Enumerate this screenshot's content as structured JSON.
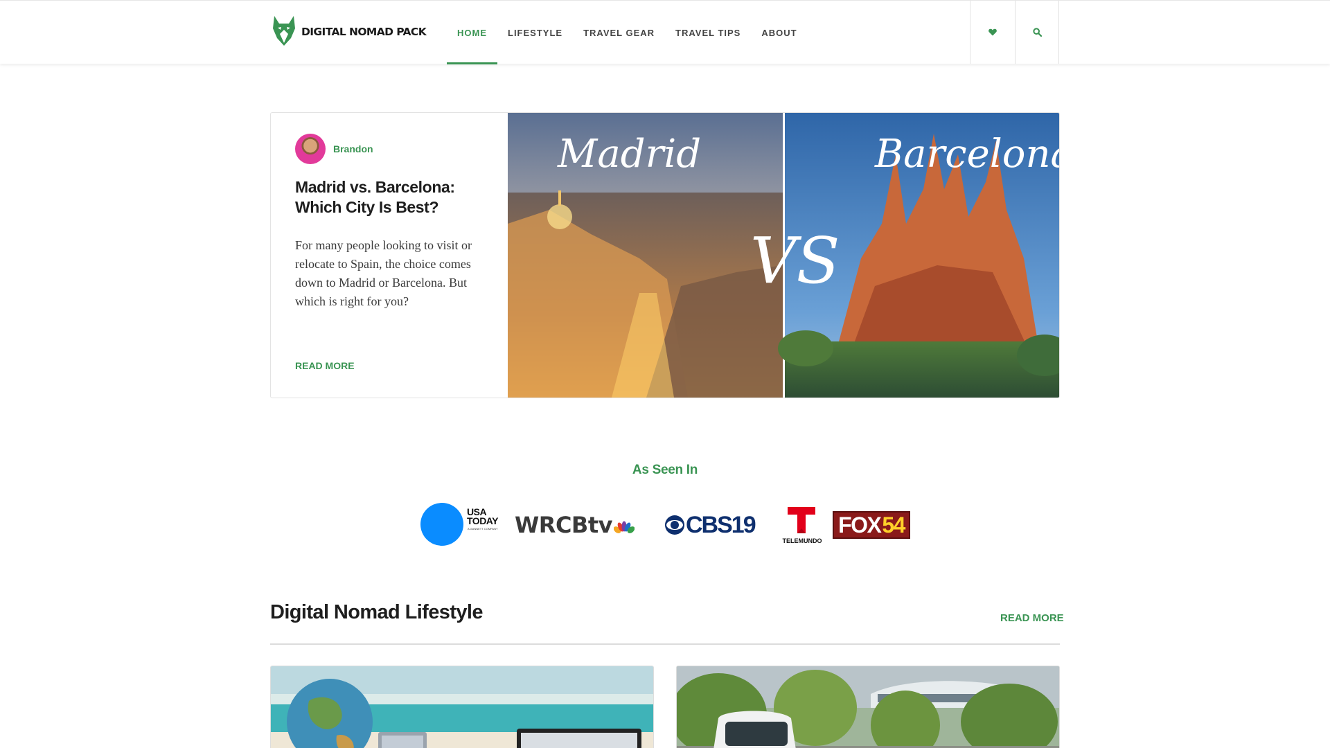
{
  "brand": {
    "name": "DIGITAL NOMAD PACK",
    "accent": "#3a9453"
  },
  "nav": {
    "items": [
      {
        "label": "HOME",
        "active": true
      },
      {
        "label": "LIFESTYLE",
        "active": false
      },
      {
        "label": "TRAVEL GEAR",
        "active": false
      },
      {
        "label": "TRAVEL TIPS",
        "active": false
      },
      {
        "label": "ABOUT",
        "active": false
      }
    ],
    "icons": [
      "heart-icon",
      "search-icon"
    ]
  },
  "featured": {
    "author": "Brandon",
    "title": "Madrid vs. Barcelona: Which City Is Best?",
    "excerpt": "For many people looking to visit or relocate to Spain, the choice comes down to Madrid or Barcelona. But which is right for you?",
    "read_more": "READ MORE",
    "image": {
      "left_label": "Madrid",
      "center_label": "VS",
      "right_label": "Barcelona"
    }
  },
  "as_seen_in": {
    "title": "As Seen In",
    "logos": [
      {
        "name": "USA TODAY",
        "line1": "USA",
        "line2": "TODAY",
        "tagline": "A GANNETT COMPANY"
      },
      {
        "name": "WRCBtv",
        "text": "WRCBtv"
      },
      {
        "name": "CBS19",
        "text": "CBS19"
      },
      {
        "name": "Telemundo",
        "text": "TELEMUNDO"
      },
      {
        "name": "FOX54",
        "text_fox": "FOX",
        "text_num": "54"
      }
    ]
  },
  "lifestyle_section": {
    "title": "Digital Nomad Lifestyle",
    "read_more": "READ MORE"
  }
}
